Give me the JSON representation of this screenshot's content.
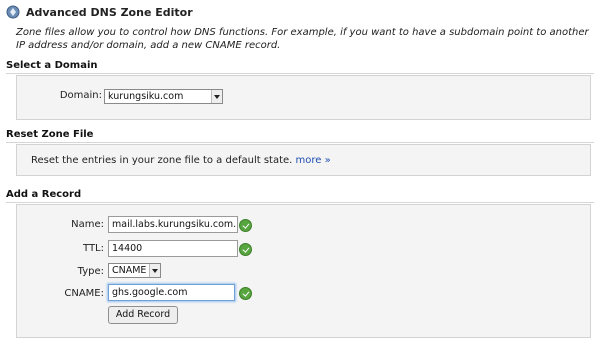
{
  "header": {
    "title": "Advanced DNS Zone Editor",
    "icon": "dns-editor-icon"
  },
  "intro": "Zone files allow you to control how DNS functions. For example, if you want to have a subdomain point to another IP address and/or domain, add a new CNAME record.",
  "select_domain": {
    "title": "Select a Domain",
    "label": "Domain:",
    "value": "kurungsiku.com"
  },
  "reset_zone": {
    "title": "Reset Zone File",
    "text": "Reset the entries in your zone file to a default state.",
    "more": "more »"
  },
  "add_record": {
    "title": "Add a Record",
    "name_label": "Name:",
    "name_value": "mail.labs.kurungsiku.com.",
    "ttl_label": "TTL:",
    "ttl_value": "14400",
    "type_label": "Type:",
    "type_value": "CNAME",
    "cname_label": "CNAME:",
    "cname_value": "ghs.google.com",
    "button": "Add Record"
  },
  "colors": {
    "valid": "#56a53e",
    "link": "#1f4fb0",
    "panel_bg": "#f4f4f4"
  }
}
